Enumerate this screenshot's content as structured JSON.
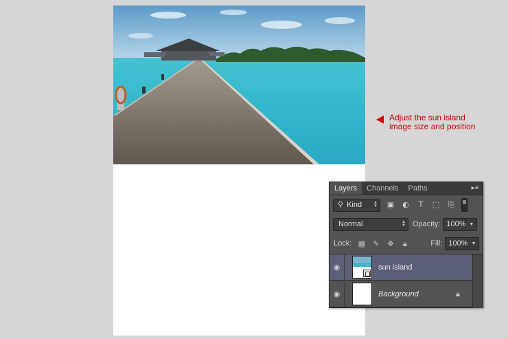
{
  "annotation": {
    "line1": "Adjust the sun island",
    "line2": "image size and position",
    "color": "#cc0000"
  },
  "canvas": {
    "image_description_icon": "photo-pier-ocean"
  },
  "layers_panel": {
    "tabs": [
      {
        "label": "Layers",
        "active": true
      },
      {
        "label": "Channels",
        "active": false
      },
      {
        "label": "Paths",
        "active": false
      }
    ],
    "menu_icon": "panel-menu-icon",
    "filter": {
      "kind_label": "Kind",
      "icons": [
        "pixel-filter-icon",
        "adjustment-filter-icon",
        "type-filter-icon",
        "shape-filter-icon",
        "smart-object-filter-icon"
      ]
    },
    "blend_mode": "Normal",
    "opacity_label": "Opacity:",
    "opacity_value": "100%",
    "lock_label": "Lock:",
    "lock_icons": [
      "lock-transparent-icon",
      "lock-pixels-icon",
      "lock-position-icon",
      "lock-all-icon"
    ],
    "fill_label": "Fill:",
    "fill_value": "100%",
    "layers": [
      {
        "name": "sun island",
        "selected": true,
        "visible": true
      },
      {
        "name": "Background",
        "selected": false,
        "visible": true,
        "locked": true
      }
    ],
    "selection_color": "#5b6078"
  }
}
